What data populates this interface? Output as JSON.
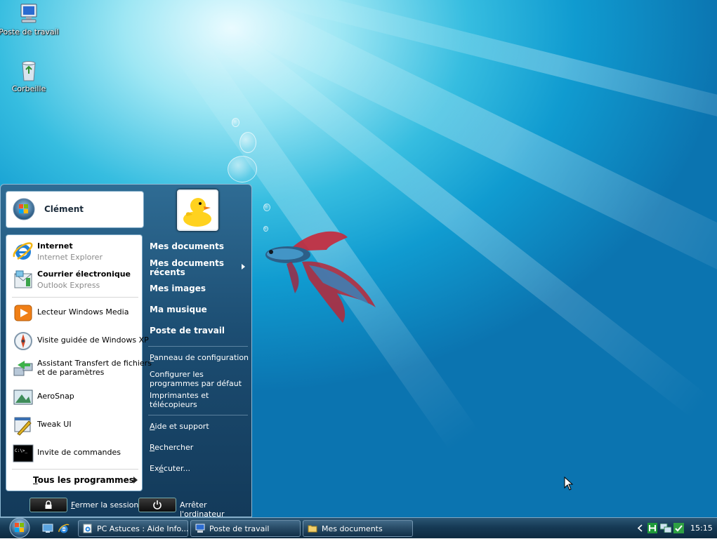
{
  "desktop": {
    "icons": [
      {
        "label": "Poste de travail",
        "icon": "computer-icon"
      },
      {
        "label": "Corbeille",
        "icon": "recycle-bin-icon"
      }
    ]
  },
  "start_menu": {
    "user_name": "Clément",
    "pinned": [
      {
        "title": "Internet",
        "subtitle": "Internet Explorer",
        "icon": "internet-explorer-icon"
      },
      {
        "title": "Courrier électronique",
        "subtitle": "Outlook Express",
        "icon": "outlook-express-icon"
      }
    ],
    "recent": [
      {
        "label": "Lecteur Windows Media",
        "icon": "media-player-icon"
      },
      {
        "label": "Visite guidée de Windows XP",
        "icon": "tour-icon"
      },
      {
        "label_line1": "Assistant Transfert de fichiers",
        "label_line2": "et de paramètres",
        "icon": "transfer-wizard-icon"
      },
      {
        "label": "AeroSnap",
        "icon": "aerosnap-icon"
      },
      {
        "label": "Tweak UI",
        "icon": "tweak-ui-icon"
      },
      {
        "label": "Invite de commandes",
        "icon": "command-prompt-icon"
      }
    ],
    "all_programs": {
      "hot": "T",
      "rest": "ous les programmes"
    },
    "right": {
      "mes_documents": "Mes documents",
      "recent_docs_line1": "Mes documents",
      "recent_docs_line2": "récents",
      "mes_images": "Mes images",
      "ma_musique": "Ma musique",
      "poste": "Poste de travail",
      "panneau": {
        "hot": "P",
        "rest": "anneau de configuration"
      },
      "configurer_line1": "Configurer les",
      "configurer_line2": "programmes par défaut",
      "imprimantes_line1": "Imprimantes et",
      "imprimantes_line2": "télécopieurs",
      "aide": {
        "hot": "A",
        "rest": "ide et support"
      },
      "rechercher": {
        "hot": "R",
        "rest": "echercher"
      },
      "executer": {
        "pre": "Ex",
        "hot": "é",
        "rest": "cuter..."
      }
    },
    "logoff": {
      "hot": "F",
      "rest": "ermer la session"
    },
    "shutdown": {
      "pre": "Arrêter l'",
      "hot": "o",
      "rest": "rdinateur"
    }
  },
  "taskbar": {
    "tasks": [
      {
        "label": "PC Astuces : Aide Info...",
        "icon": "ie-page-icon"
      },
      {
        "label": "Poste de travail",
        "icon": "computer-icon"
      },
      {
        "label": "Mes documents",
        "icon": "folder-icon"
      }
    ],
    "clock": "15:15"
  }
}
